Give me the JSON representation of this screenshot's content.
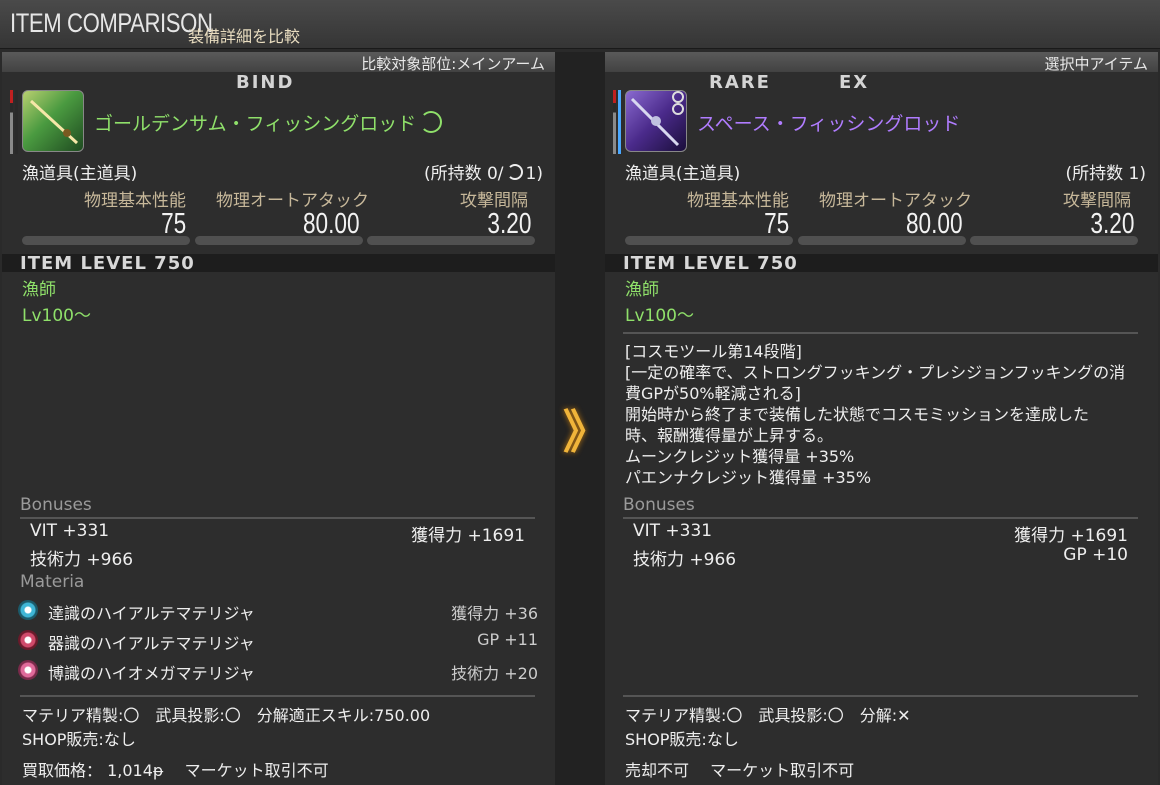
{
  "window": {
    "title": "ITEM COMPARISON",
    "subtitle": "装備詳細を比較"
  },
  "left": {
    "header": "比較対象部位:メインアーム",
    "flags": [
      "BIND"
    ],
    "item_name": "ゴールデンサム・フィッシングロッド",
    "item_name_color": "#8fe06a",
    "category": "漁道具(主道具)",
    "owned": "(所持数 0/",
    "owned_suffix": "1)",
    "stats": [
      {
        "label": "物理基本性能",
        "value": "75"
      },
      {
        "label": "物理オートアタック",
        "value": "80.00"
      },
      {
        "label": "攻撃間隔",
        "value": "3.20"
      }
    ],
    "item_level": "ITEM LEVEL 750",
    "job": "漁師",
    "level": "Lv100～",
    "bonuses_label": "Bonuses",
    "bonuses": [
      {
        "left": "VIT +331",
        "right": "獲得力 +1691"
      },
      {
        "left": "技術力 +966",
        "right": ""
      }
    ],
    "materia_label": "Materia",
    "materia": [
      {
        "name": "達識のハイアルテマテリジャ",
        "value": "獲得力 +36",
        "color": "#3fb6d6"
      },
      {
        "name": "器識のハイアルテマテリジャ",
        "value": "GP +11",
        "color": "#d04a6a"
      },
      {
        "name": "博識のハイオメガマテリジャ",
        "value": "技術力 +20",
        "color": "#e06a9a"
      }
    ],
    "footer": [
      "マテリア精製:〇　武具投影:〇　分解適正スキル:750.00",
      "SHOP販売:なし",
      "買取価格： 1,014ᵽ　 マーケット取引不可"
    ]
  },
  "right": {
    "header": "選択中アイテム",
    "flags": [
      "RARE",
      "EX"
    ],
    "item_name": "スペース・フィッシングロッド",
    "item_name_color": "#b07cff",
    "category": "漁道具(主道具)",
    "owned": "(所持数 1)",
    "stats": [
      {
        "label": "物理基本性能",
        "value": "75"
      },
      {
        "label": "物理オートアタック",
        "value": "80.00"
      },
      {
        "label": "攻撃間隔",
        "value": "3.20"
      }
    ],
    "item_level": "ITEM LEVEL 750",
    "job": "漁師",
    "level": "Lv100～",
    "description": [
      "[コスモツール第14段階]",
      "[一定の確率で、ストロングフッキング・プレシジョンフッキングの消",
      "費GPが50%軽減される]",
      "開始時から終了まで装備した状態でコスモミッションを達成した",
      "時、報酬獲得量が上昇する。",
      "ムーンクレジット獲得量 +35%",
      "パエンナクレジット獲得量 +35%"
    ],
    "bonuses_label": "Bonuses",
    "bonuses": [
      {
        "left": "VIT +331",
        "right": "獲得力 +1691"
      },
      {
        "left": "技術力 +966",
        "right": "GP +10"
      }
    ],
    "footer": [
      "マテリア精製:〇　武具投影:〇　分解:✕",
      "SHOP販売:なし",
      "売却不可　 マーケット取引不可"
    ]
  },
  "compare_arrow": "》"
}
